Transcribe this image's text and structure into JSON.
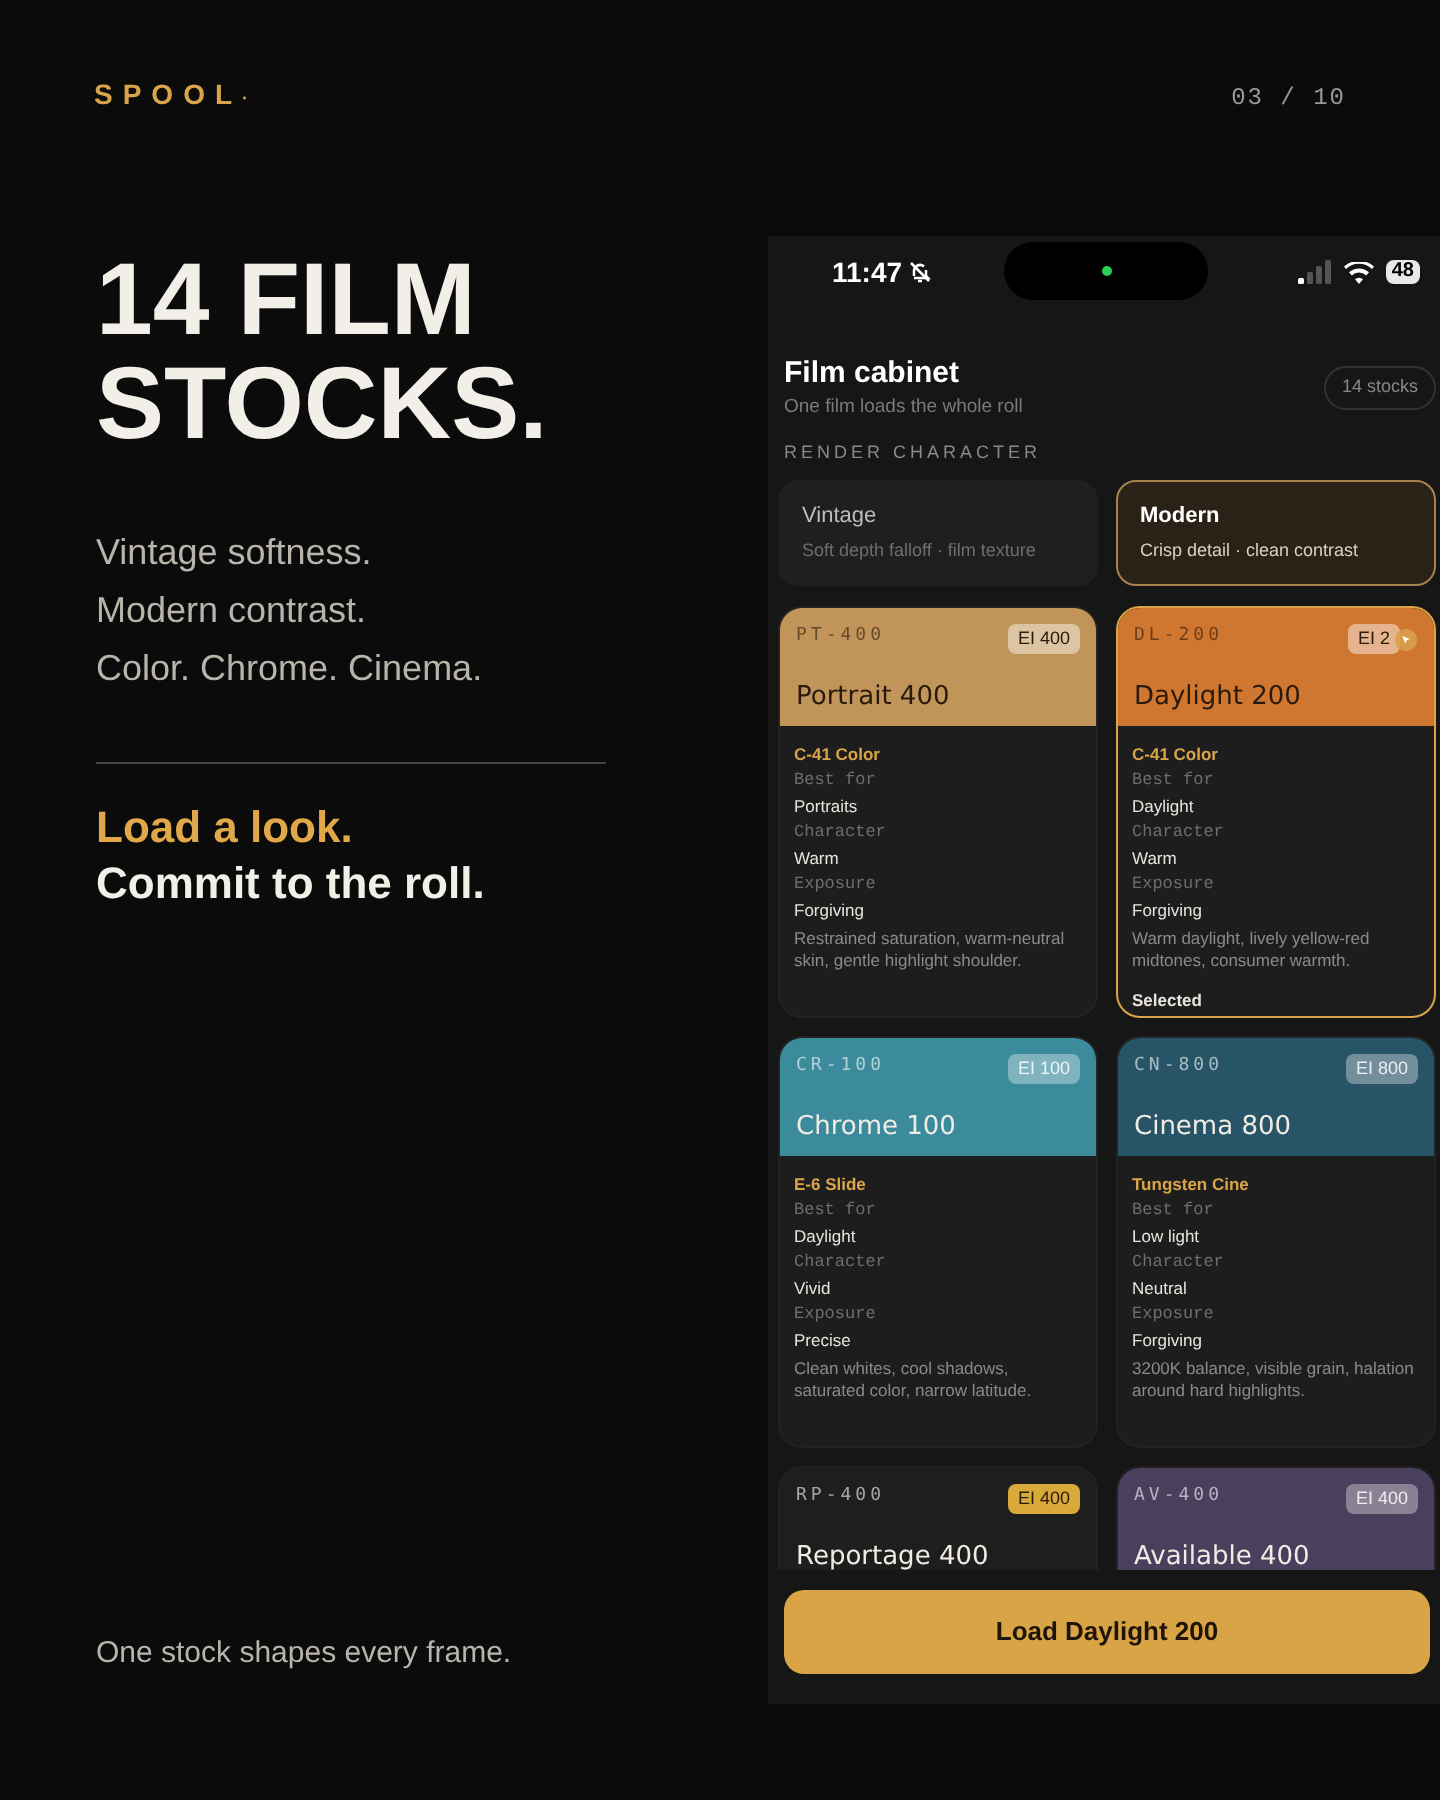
{
  "brand": {
    "logo": "SPOOL",
    "dot": "·"
  },
  "page_counter": "03 / 10",
  "hero": {
    "title": [
      "14 FILM",
      "STOCKS."
    ],
    "lines": [
      "Vintage softness.",
      "Modern contrast.",
      "Color. Chrome. Cinema."
    ],
    "accent": "Load a look.",
    "tagline": "Commit to the roll.",
    "footer": "One stock shapes every frame."
  },
  "status_bar": {
    "time": "11:47",
    "battery": "48"
  },
  "cabinet": {
    "title": "Film cabinet",
    "subtitle": "One film loads the whole roll",
    "count": "14 stocks",
    "section_label": "RENDER CHARACTER"
  },
  "render_modes": [
    {
      "label": "Vintage",
      "detail": "Soft depth falloff · film texture",
      "selected": false
    },
    {
      "label": "Modern",
      "detail": "Crisp detail · clean contrast",
      "selected": true
    }
  ],
  "stocks": [
    {
      "code": "PT-400",
      "ei": "EI 400",
      "name": "Portrait 400",
      "color": "#c1955a",
      "process": "C-41 Color",
      "best_label": "Best for",
      "best": "Portraits",
      "character_label": "Character",
      "character": "Warm",
      "exposure_label": "Exposure",
      "exposure": "Forgiving",
      "description": "Restrained saturation, warm-neutral skin, gentle highlight shoulder.",
      "selected": false
    },
    {
      "code": "DL-200",
      "ei": "EI 2",
      "name": "Daylight 200",
      "color": "#cf7630",
      "process": "C-41 Color",
      "best_label": "Best for",
      "best": "Daylight",
      "character_label": "Character",
      "character": "Warm",
      "exposure_label": "Exposure",
      "exposure": "Forgiving",
      "description": "Warm daylight, lively yellow-red midtones, consumer warmth.",
      "selected": true,
      "status": "Selected"
    },
    {
      "code": "CR-100",
      "ei": "EI 100",
      "name": "Chrome 100",
      "color": "#3b8b9c",
      "process": "E-6 Slide",
      "best_label": "Best for",
      "best": "Daylight",
      "character_label": "Character",
      "character": "Vivid",
      "exposure_label": "Exposure",
      "exposure": "Precise",
      "description": "Clean whites, cool shadows, saturated color, narrow latitude.",
      "selected": false
    },
    {
      "code": "CN-800",
      "ei": "EI 800",
      "name": "Cinema 800",
      "color": "#275466",
      "process": "Tungsten Cine",
      "best_label": "Best for",
      "best": "Low light",
      "character_label": "Character",
      "character": "Neutral",
      "exposure_label": "Exposure",
      "exposure": "Forgiving",
      "description": "3200K balance, visible grain, halation around hard highlights.",
      "selected": false
    },
    {
      "code": "RP-400",
      "ei": "EI 400",
      "name": "Reportage 400",
      "color": "#1e1e1e",
      "selected": false
    },
    {
      "code": "AV-400",
      "ei": "EI 400",
      "name": "Available 400",
      "color": "#4a3f5c",
      "selected": false
    }
  ],
  "load_button": "Load Daylight 200"
}
